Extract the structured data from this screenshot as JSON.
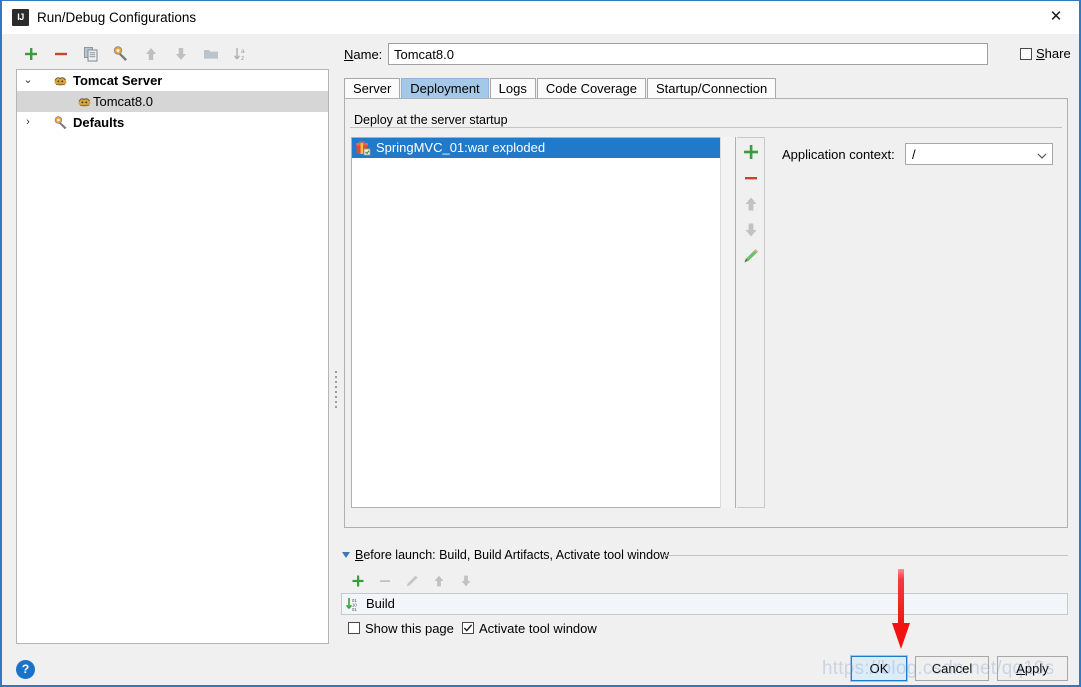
{
  "window": {
    "title": "Run/Debug Configurations",
    "app_icon": "IJ",
    "close_icon": "✕"
  },
  "left_toolbar": {
    "icons": [
      {
        "name": "add-icon",
        "glyph": "+"
      },
      {
        "name": "remove-icon",
        "glyph": "−"
      },
      {
        "name": "copy-configuration-icon",
        "glyph": "⎘"
      },
      {
        "name": "edit-templates-icon",
        "glyph": "⚙"
      },
      {
        "name": "move-up-icon",
        "glyph": "↑"
      },
      {
        "name": "move-down-icon",
        "glyph": "↓"
      },
      {
        "name": "create-folder-icon",
        "glyph": "▭"
      },
      {
        "name": "sort-alphabetically-icon",
        "glyph": "↓az"
      }
    ]
  },
  "tree": {
    "items": [
      {
        "label": "Tomcat Server",
        "expanded": true,
        "bold": true,
        "selected": false,
        "arrow": "⌄",
        "icon": "tomcat-icon",
        "indent": 16
      },
      {
        "label": "Tomcat8.0",
        "expanded": false,
        "bold": false,
        "selected": true,
        "arrow": "",
        "icon": "tomcat-icon",
        "indent": 44
      },
      {
        "label": "Defaults",
        "expanded": false,
        "bold": true,
        "selected": false,
        "arrow": "›",
        "icon": "wrench-icon",
        "indent": 16
      }
    ]
  },
  "name_field": {
    "label": "Name:",
    "label_mnemonic": "N",
    "value": "Tomcat8.0",
    "placeholder": ""
  },
  "share": {
    "label": "Share",
    "mnemonic": "S",
    "checked": false
  },
  "tabs": [
    {
      "label": "Server",
      "active": false
    },
    {
      "label": "Deployment",
      "active": true
    },
    {
      "label": "Logs",
      "active": false
    },
    {
      "label": "Code Coverage",
      "active": false
    },
    {
      "label": "Startup/Connection",
      "active": false
    }
  ],
  "deployment": {
    "group_title": "Deploy at the server startup",
    "items": [
      {
        "label": "SpringMVC_01:war exploded",
        "selected": true,
        "icon": "artifact-icon"
      }
    ],
    "side_buttons": [
      {
        "name": "add-artifact-button",
        "glyph": "+",
        "color": "#3a9c3a",
        "enabled": true
      },
      {
        "name": "remove-artifact-button",
        "glyph": "−",
        "color": "#c3472a",
        "enabled": true
      },
      {
        "name": "move-artifact-up-button",
        "glyph": "↑",
        "color": "#c2c2c2",
        "enabled": false
      },
      {
        "name": "move-artifact-down-button",
        "glyph": "↓",
        "color": "#c2c2c2",
        "enabled": false
      },
      {
        "name": "edit-artifact-button",
        "glyph": "✎",
        "color": "#4da64d",
        "enabled": true
      }
    ],
    "application_context": {
      "label": "Application context:",
      "value": "/",
      "options": [
        "/"
      ]
    }
  },
  "before_launch": {
    "title": "Before launch: Build, Build Artifacts, Activate tool window",
    "title_mnemonic": "B",
    "toolbar": [
      {
        "name": "add-task-button",
        "glyph": "+",
        "color": "#3a9c3a",
        "enabled": true
      },
      {
        "name": "remove-task-button",
        "glyph": "−",
        "color": "#c2c2c2",
        "enabled": false
      },
      {
        "name": "edit-task-button",
        "glyph": "✎",
        "color": "#c2c2c2",
        "enabled": false
      },
      {
        "name": "move-task-up-button",
        "glyph": "↑",
        "color": "#c2c2c2",
        "enabled": false
      },
      {
        "name": "move-task-down-button",
        "glyph": "↓",
        "color": "#c2c2c2",
        "enabled": false
      }
    ],
    "tasks": [
      {
        "label": "Build",
        "icon": "compile-icon"
      }
    ],
    "checkboxes": [
      {
        "name": "show-this-page-checkbox",
        "label": "Show this page",
        "checked": false
      },
      {
        "name": "activate-tool-window-checkbox",
        "label": "Activate tool window",
        "checked": true
      }
    ]
  },
  "buttons": {
    "ok": "OK",
    "cancel": "Cancel",
    "apply": "Apply",
    "apply_mnemonic": "A",
    "help": "?"
  },
  "annotation": {
    "arrow_color": "#f32020",
    "points_to": "ok-button"
  },
  "watermark": {
    "text": "https://blog.csdn.net/qq19s"
  },
  "colors": {
    "accent_blue": "#2079c9",
    "window_border": "#2f78c5",
    "tab_active": "#a6c8e8",
    "tree_selection": "#d6d6d6",
    "dialog_bg": "#f0f0f0",
    "green": "#3a9c3a",
    "red": "#c3472a"
  }
}
